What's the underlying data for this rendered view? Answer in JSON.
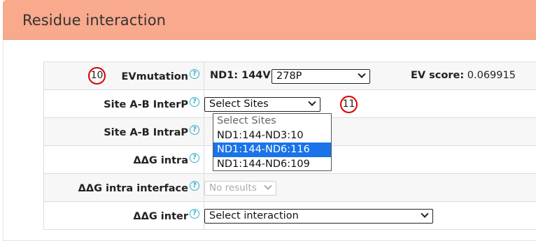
{
  "panel": {
    "title": "Residue interaction"
  },
  "rows": {
    "evmutation": {
      "label": "EVmutation",
      "badge": "10",
      "prefix": "ND1: 144V -",
      "select_value": "278P",
      "score_label": "EV score:",
      "score_value": "0.069915"
    },
    "site_ab_interp": {
      "label": "Site A-B InterP",
      "select_value": "Select Sites",
      "badge": "11",
      "dropdown_options": [
        "Select Sites",
        "ND1:144-ND3:10",
        "ND1:144-ND6:116",
        "ND1:144-ND6:109"
      ],
      "highlighted_option": "ND1:144-ND6:116"
    },
    "site_ab_intrap": {
      "label": "Site A-B IntraP"
    },
    "ddg_intra": {
      "label": "ΔΔG intra"
    },
    "ddg_intra_interface": {
      "label": "ΔΔG intra interface",
      "select_value": "No results"
    },
    "ddg_inter": {
      "label": "ΔΔG inter",
      "select_value": "Select interaction"
    }
  },
  "help_icon_glyph": "?",
  "colors": {
    "header_bg": "#f9a98c",
    "help_icon": "#35b1c9",
    "badge_ring": "#d90000",
    "highlight": "#1a73e8"
  }
}
